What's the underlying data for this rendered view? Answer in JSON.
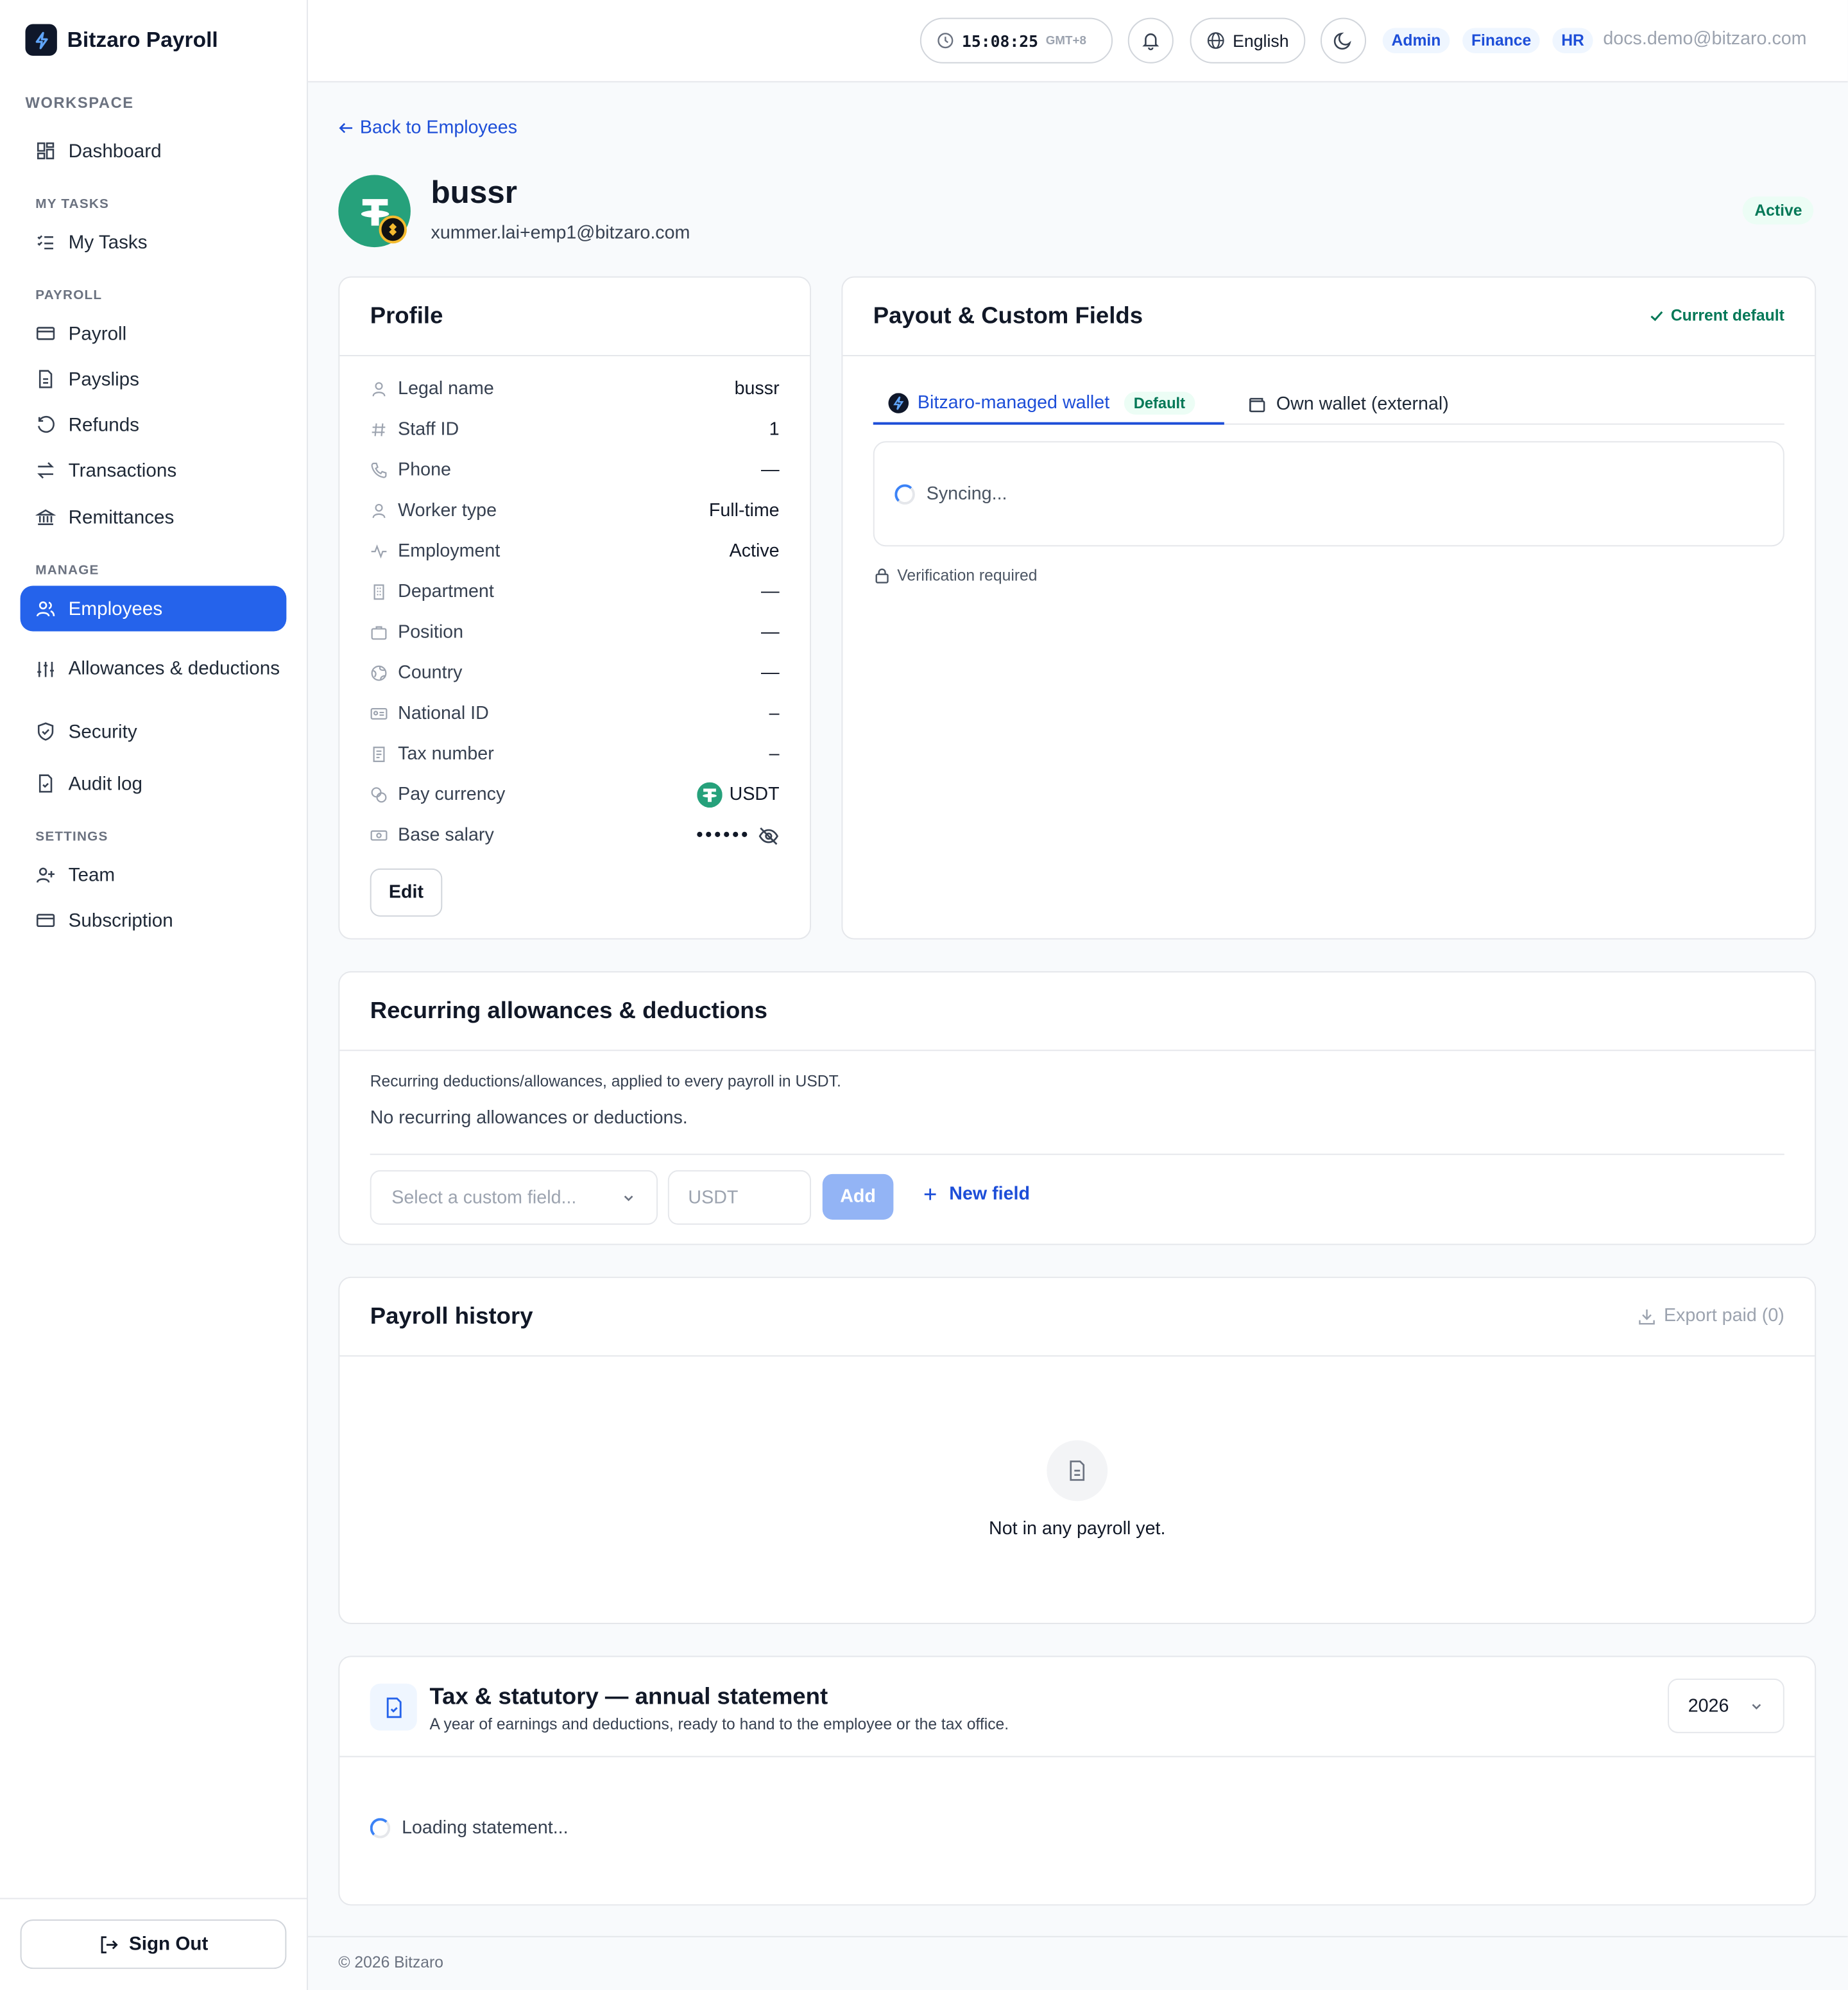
{
  "app": {
    "name": "Bitzaro Payroll"
  },
  "sidebar": {
    "workspace_label": "WORKSPACE",
    "sections": {
      "my_tasks": "MY TASKS",
      "payroll": "PAYROLL",
      "manage": "MANAGE",
      "settings": "SETTINGS"
    },
    "items": {
      "dashboard": "Dashboard",
      "my_tasks": "My Tasks",
      "payroll": "Payroll",
      "payslips": "Payslips",
      "refunds": "Refunds",
      "transactions": "Transactions",
      "remittances": "Remittances",
      "employees": "Employees",
      "allowances": "Allowances & deductions",
      "security": "Security",
      "audit_log": "Audit log",
      "team": "Team",
      "subscription": "Subscription"
    },
    "sign_out": "Sign Out",
    "active_item": "Employees"
  },
  "topbar": {
    "clock_time": "15:08:25",
    "clock_tz": "GMT+8",
    "language": "English",
    "roles": [
      "Admin",
      "Finance",
      "HR"
    ],
    "user_email": "docs.demo@bitzaro.com"
  },
  "employee": {
    "back_link": "Back to Employees",
    "name": "bussr",
    "email": "xummer.lai+emp1@bitzaro.com",
    "status": "Active"
  },
  "profile": {
    "title": "Profile",
    "rows": [
      {
        "icon": "user-icon",
        "label": "Legal name",
        "value": "bussr"
      },
      {
        "icon": "hash-icon",
        "label": "Staff ID",
        "value": "1"
      },
      {
        "icon": "phone-icon",
        "label": "Phone",
        "value": "—"
      },
      {
        "icon": "person-icon",
        "label": "Worker type",
        "value": "Full-time"
      },
      {
        "icon": "activity-icon",
        "label": "Employment",
        "value": "Active"
      },
      {
        "icon": "building-icon",
        "label": "Department",
        "value": "—"
      },
      {
        "icon": "briefcase-icon",
        "label": "Position",
        "value": "—"
      },
      {
        "icon": "globe-icon",
        "label": "Country",
        "value": "—"
      },
      {
        "icon": "id-card-icon",
        "label": "National ID",
        "value": "–"
      },
      {
        "icon": "receipt-icon",
        "label": "Tax number",
        "value": "–"
      },
      {
        "icon": "coins-icon",
        "label": "Pay currency",
        "value": "USDT"
      },
      {
        "icon": "banknote-icon",
        "label": "Base salary",
        "value": "••••••"
      }
    ],
    "edit_label": "Edit"
  },
  "payout": {
    "title": "Payout & Custom Fields",
    "current_default": "Current default",
    "tabs": {
      "managed": "Bitzaro-managed wallet",
      "managed_badge": "Default",
      "external": "Own wallet (external)"
    },
    "syncing": "Syncing...",
    "verification": "Verification required"
  },
  "recurring": {
    "title": "Recurring allowances & deductions",
    "description": "Recurring deductions/allowances, applied to every payroll in USDT.",
    "empty": "No recurring allowances or deductions.",
    "select_placeholder": "Select a custom field...",
    "amount_placeholder": "USDT",
    "add_label": "Add",
    "new_field_label": "New field"
  },
  "payroll_history": {
    "title": "Payroll history",
    "export_label": "Export paid (0)",
    "empty": "Not in any payroll yet."
  },
  "tax": {
    "title": "Tax & statutory — annual statement",
    "subtitle": "A year of earnings and deductions, ready to hand to the employee or the tax office.",
    "year": "2026",
    "loading": "Loading statement..."
  },
  "footer": {
    "copyright": "© 2026 Bitzaro"
  },
  "colors": {
    "accent": "#2563eb",
    "link": "#1d4ed8",
    "success": "#047857",
    "tether": "#26a17b"
  }
}
